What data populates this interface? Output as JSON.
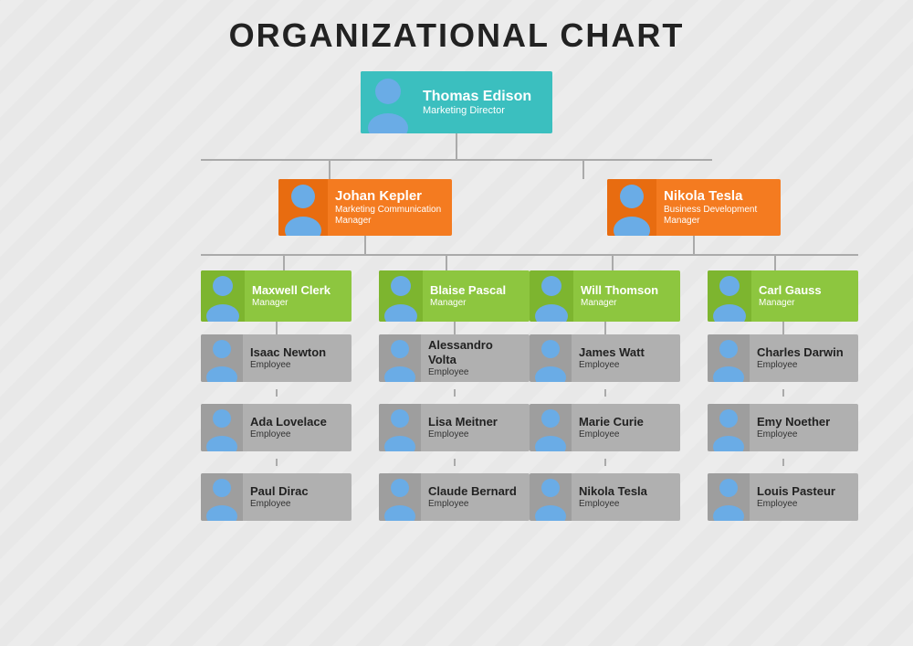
{
  "title": "ORGANIZATIONAL CHART",
  "colors": {
    "teal": "#3bbfbf",
    "orange": "#f47b20",
    "green": "#8dc63f",
    "gray": "#b0b0b0",
    "line": "#aaaaaa"
  },
  "nodes": {
    "top": {
      "name": "Thomas Edison",
      "title": "Marketing Director",
      "gender": "male"
    },
    "l2": [
      {
        "name": "Johan Kepler",
        "title": "Marketing Communication Manager",
        "gender": "female"
      },
      {
        "name": "Nikola Tesla",
        "title": "Business Development Manager",
        "gender": "male"
      }
    ],
    "l3": [
      {
        "name": "Maxwell Clerk",
        "title": "Manager",
        "gender": "male",
        "parent": 0
      },
      {
        "name": "Blaise Pascal",
        "title": "Manager",
        "gender": "male",
        "parent": 0
      },
      {
        "name": "Will Thomson",
        "title": "Manager",
        "gender": "male",
        "parent": 1
      },
      {
        "name": "Carl Gauss",
        "title": "Manager",
        "gender": "male",
        "parent": 1
      }
    ],
    "l4": [
      [
        {
          "name": "Isaac Newton",
          "title": "Employee",
          "gender": "male"
        },
        {
          "name": "Ada Lovelace",
          "title": "Employee",
          "gender": "female"
        },
        {
          "name": "Paul Dirac",
          "title": "Employee",
          "gender": "male"
        }
      ],
      [
        {
          "name": "Alessandro Volta",
          "title": "Employee",
          "gender": "male"
        },
        {
          "name": "Lisa Meitner",
          "title": "Employee",
          "gender": "female"
        },
        {
          "name": "Claude Bernard",
          "title": "Employee",
          "gender": "male"
        }
      ],
      [
        {
          "name": "James Watt",
          "title": "Employee",
          "gender": "male"
        },
        {
          "name": "Marie Curie",
          "title": "Employee",
          "gender": "female"
        },
        {
          "name": "Nikola Tesla",
          "title": "Employee",
          "gender": "male"
        }
      ],
      [
        {
          "name": "Charles Darwin",
          "title": "Employee",
          "gender": "male"
        },
        {
          "name": "Emy Noether",
          "title": "Employee",
          "gender": "female"
        },
        {
          "name": "Louis Pasteur",
          "title": "Employee",
          "gender": "male"
        }
      ]
    ]
  }
}
